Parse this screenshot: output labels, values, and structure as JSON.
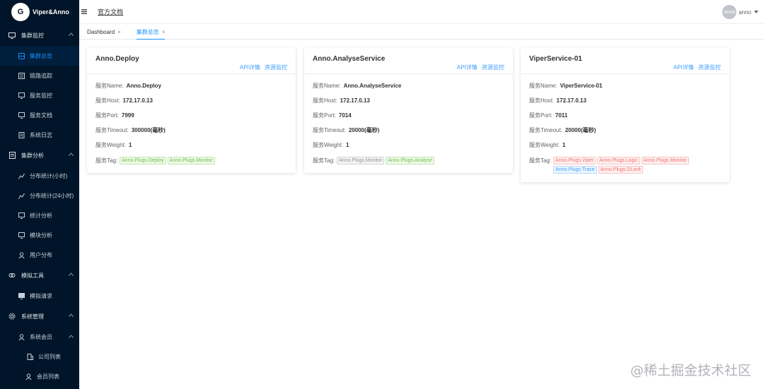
{
  "brand": {
    "logo_char": "G",
    "name": "Viper&Anno"
  },
  "header": {
    "doc_link": "官方文档",
    "avatar_text": "anno",
    "user_name": "anno"
  },
  "sidebar": {
    "groups": [
      {
        "label": "集群监控",
        "icon": "monitor-icon",
        "items": [
          {
            "label": "集群总览",
            "icon": "cluster-icon",
            "active": true
          },
          {
            "label": "链路追踪",
            "icon": "trace-icon"
          },
          {
            "label": "服务监控",
            "icon": "screen-icon"
          },
          {
            "label": "服务文档",
            "icon": "doc-icon"
          },
          {
            "label": "系统日志",
            "icon": "log-icon"
          }
        ]
      },
      {
        "label": "集群分析",
        "icon": "document-icon",
        "items": [
          {
            "label": "分布统计(小时)",
            "icon": "chart-icon"
          },
          {
            "label": "分布统计(24小时)",
            "icon": "chart-icon"
          },
          {
            "label": "统计分析",
            "icon": "screen-icon"
          },
          {
            "label": "模块分析",
            "icon": "screen-icon"
          },
          {
            "label": "用户分布",
            "icon": "user-icon"
          }
        ]
      },
      {
        "label": "模拟工具",
        "icon": "tool-icon",
        "items": [
          {
            "label": "模拟请求",
            "icon": "screen-icon"
          }
        ]
      },
      {
        "label": "系统管理",
        "icon": "gear-icon",
        "items": [
          {
            "label": "系统会员",
            "icon": "user-icon"
          },
          {
            "label": "公司列表",
            "icon": "building-icon"
          },
          {
            "label": "会员列表",
            "icon": "user-icon"
          }
        ]
      }
    ]
  },
  "tabs": [
    {
      "label": "Dashboard",
      "close": "×"
    },
    {
      "label": "集群总览",
      "close": "×"
    }
  ],
  "cards": [
    {
      "title": "Anno.Deploy",
      "links": [
        "API详情",
        "资源监控"
      ],
      "fields": [
        {
          "label": "服务Name:",
          "value": "Anno.Deploy"
        },
        {
          "label": "服务Host:",
          "value": "172.17.0.13"
        },
        {
          "label": "服务Port:",
          "value": "7999"
        },
        {
          "label": "服务Timeout:",
          "value": "300000(毫秒)"
        },
        {
          "label": "服务Weight:",
          "value": "1"
        }
      ],
      "tag_label": "服务Tag:",
      "tags": [
        {
          "text": "Anno.Plugs.Deploy",
          "color": "green"
        },
        {
          "text": "Anno.Plugs.Monitor",
          "color": "green"
        }
      ]
    },
    {
      "title": "Anno.AnalyseService",
      "links": [
        "API详情",
        "资源监控"
      ],
      "fields": [
        {
          "label": "服务Name:",
          "value": "Anno.AnalyseService"
        },
        {
          "label": "服务Host:",
          "value": "172.17.0.13"
        },
        {
          "label": "服务Port:",
          "value": "7014"
        },
        {
          "label": "服务Timeout:",
          "value": "20000(毫秒)"
        },
        {
          "label": "服务Weight:",
          "value": "1"
        }
      ],
      "tag_label": "服务Tag:",
      "tags": [
        {
          "text": "Anno.Plugs.Monitor",
          "color": "gray"
        },
        {
          "text": "Anno.Plugs.Analyse",
          "color": "green"
        }
      ]
    },
    {
      "title": "ViperService-01",
      "links": [
        "API详情",
        "资源监控"
      ],
      "fields": [
        {
          "label": "服务Name:",
          "value": "ViperService-01"
        },
        {
          "label": "服务Host:",
          "value": "172.17.0.13"
        },
        {
          "label": "服务Port:",
          "value": "7011"
        },
        {
          "label": "服务Timeout:",
          "value": "20000(毫秒)"
        },
        {
          "label": "服务Weight:",
          "value": "1"
        }
      ],
      "tag_label": "服务Tag:",
      "tags": [
        {
          "text": "Anno.Plugs.Viper",
          "color": "red"
        },
        {
          "text": "Anno.Plugs.Logic",
          "color": "red"
        },
        {
          "text": "Anno.Plugs.Monitor",
          "color": "red"
        },
        {
          "text": "Anno.Plugs.Trace",
          "color": "blue"
        },
        {
          "text": "Anno.Plugs.DLock",
          "color": "red"
        }
      ]
    }
  ],
  "watermark": "@稀土掘金技术社区",
  "colors": {
    "sidebar_bg": "#001529",
    "accent": "#1890ff",
    "link": "#409eff"
  }
}
